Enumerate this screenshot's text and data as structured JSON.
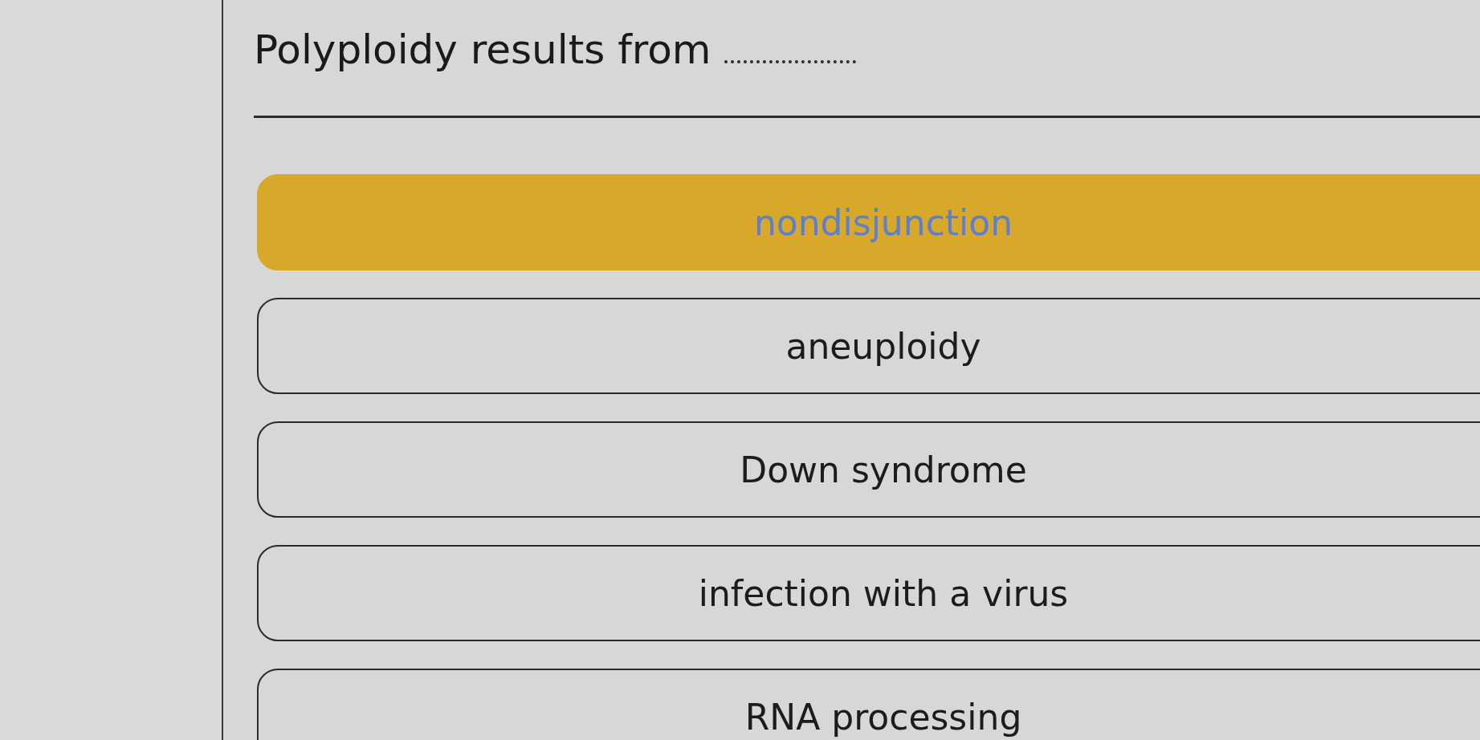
{
  "question": {
    "text": "Polyploidy results from"
  },
  "options": [
    {
      "label": "nondisjunction",
      "selected": true
    },
    {
      "label": "aneuploidy",
      "selected": false
    },
    {
      "label": "Down syndrome",
      "selected": false
    },
    {
      "label": "infection with a virus",
      "selected": false
    },
    {
      "label": "RNA processing",
      "selected": false
    }
  ]
}
